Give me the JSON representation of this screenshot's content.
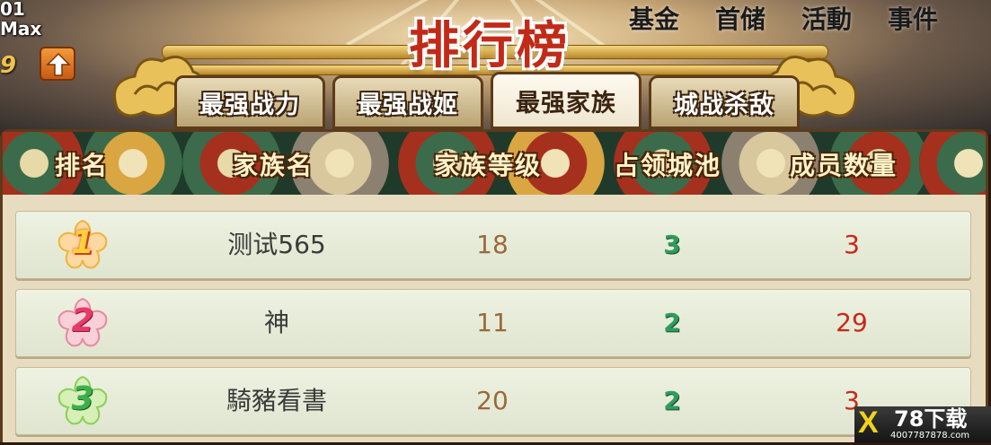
{
  "hud": {
    "level": "01",
    "max_label": "Max",
    "stat": "9",
    "upgrade_icon": "up-arrow-icon"
  },
  "top_menu": [
    "基金",
    "首储",
    "活動",
    "事件"
  ],
  "title": "排行榜",
  "tabs": [
    {
      "label": "最强战力",
      "active": false
    },
    {
      "label": "最强战姬",
      "active": false
    },
    {
      "label": "最强家族",
      "active": true
    },
    {
      "label": "城战杀敌",
      "active": false
    }
  ],
  "table": {
    "headers": [
      "排名",
      "家族名",
      "家族等级",
      "占领城池",
      "成员数量"
    ],
    "rows": [
      {
        "rank": "1",
        "name": "测试565",
        "level": "18",
        "cities": "3",
        "members": "3",
        "badge_color": "#f0b43c"
      },
      {
        "rank": "2",
        "name": "神",
        "level": "11",
        "cities": "2",
        "members": "29",
        "badge_color": "#f2a4b4"
      },
      {
        "rank": "3",
        "name": "騎豬看書",
        "level": "20",
        "cities": "2",
        "members": "3",
        "badge_color": "#9ed86a"
      }
    ]
  },
  "watermark": {
    "logo": "X",
    "text": "78下载",
    "site": "4007787878.com"
  },
  "colors": {
    "title_red": "#c22a18",
    "cities_green": "#2f9c5e",
    "members_red": "#c82818",
    "level_brown": "#9a6a3a"
  }
}
